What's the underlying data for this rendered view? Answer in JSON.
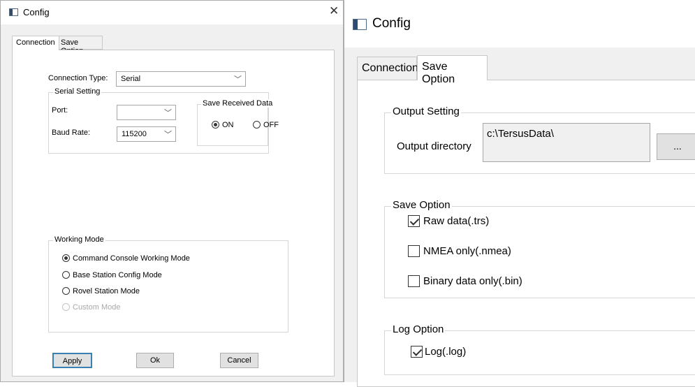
{
  "left": {
    "title": "Config",
    "close_glyph": "✕",
    "tabs": [
      "Connection",
      "Save Option"
    ],
    "connection_type_label": "Connection Type:",
    "connection_type_value": "Serial",
    "serial_setting_label": "Serial Setting",
    "port_label": "Port:",
    "port_value": "",
    "baud_label": "Baud Rate:",
    "baud_value": "115200",
    "save_received_label": "Save Received Data",
    "radio_on_label": "ON",
    "radio_off_label": "OFF",
    "working_mode_label": "Working Mode",
    "modes": [
      {
        "label": "Command Console Working Mode",
        "selected": true,
        "disabled": false
      },
      {
        "label": "Base Station Config Mode",
        "selected": false,
        "disabled": false
      },
      {
        "label": "Rovel Station Mode",
        "selected": false,
        "disabled": false
      },
      {
        "label": "Custom Mode",
        "selected": false,
        "disabled": true
      }
    ],
    "buttons": {
      "apply": "Apply",
      "ok": "Ok",
      "cancel": "Cancel"
    }
  },
  "right": {
    "title": "Config",
    "tabs": [
      "Connection",
      "Save Option"
    ],
    "output_setting_label": "Output Setting",
    "output_dir_label": "Output directory",
    "output_dir_value": "c:\\TersusData\\",
    "browse_label": "...",
    "save_option_label": "Save Option",
    "save_options": [
      {
        "label": "Raw data(.trs)",
        "checked": true
      },
      {
        "label": "NMEA only(.nmea)",
        "checked": false
      },
      {
        "label": "Binary data only(.bin)",
        "checked": false
      }
    ],
    "log_option_label": "Log Option",
    "log_checkbox": {
      "label": "Log(.log)",
      "checked": true
    }
  }
}
